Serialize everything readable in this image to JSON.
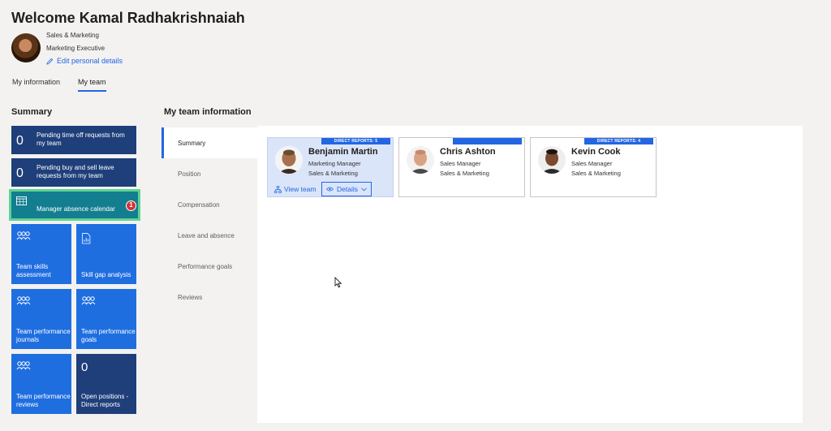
{
  "header": {
    "welcome": "Welcome Kamal Radhakrishnaiah",
    "department": "Sales & Marketing",
    "job_title": "Marketing Executive",
    "edit_link": "Edit personal details"
  },
  "tabs": [
    {
      "label": "My information",
      "active": false
    },
    {
      "label": "My team",
      "active": true
    }
  ],
  "summary": {
    "title": "Summary",
    "tiles": {
      "pending_time_off": {
        "count": "0",
        "label": "Pending time off requests from my team"
      },
      "pending_buy_sell": {
        "count": "0",
        "label": "Pending buy and sell leave requests from my team"
      },
      "manager_calendar": {
        "label": "Manager absence calendar",
        "badge": "1"
      },
      "skills_assessment": {
        "label": "Team skills assessment"
      },
      "skill_gap": {
        "label": "Skill gap analysis"
      },
      "perf_journals": {
        "label": "Team performance journals"
      },
      "perf_goals": {
        "label": "Team performance goals"
      },
      "perf_reviews": {
        "label": "Team performance reviews"
      },
      "open_positions": {
        "count": "0",
        "label": "Open positions - Direct reports"
      }
    }
  },
  "team_info": {
    "title": "My team information",
    "nav": [
      {
        "label": "Summary",
        "active": true
      },
      {
        "label": "Position",
        "active": false
      },
      {
        "label": "Compensation",
        "active": false
      },
      {
        "label": "Leave and absence",
        "active": false
      },
      {
        "label": "Performance goals",
        "active": false
      },
      {
        "label": "Reviews",
        "active": false
      }
    ],
    "cards": [
      {
        "name": "Benjamin Martin",
        "role": "Marketing Manager",
        "org": "Sales & Marketing",
        "banner": "DIRECT REPORTS: 5",
        "selected": true,
        "view_team": "View team",
        "details": "Details"
      },
      {
        "name": "Chris Ashton",
        "role": "Sales Manager",
        "org": "Sales & Marketing",
        "banner": "",
        "selected": false
      },
      {
        "name": "Kevin Cook",
        "role": "Sales Manager",
        "org": "Sales & Marketing",
        "banner": "DIRECT REPORTS: 4",
        "selected": false
      }
    ]
  },
  "colors": {
    "accent": "#2266e3",
    "tile_dark": "#1e3f7a",
    "tile_blue": "#1f6ee0",
    "tile_teal": "#127e8f",
    "highlight": "#5fd292",
    "badge": "#d13438"
  },
  "icons": [
    "pencil-icon",
    "calendar-icon",
    "people-icon",
    "report-icon",
    "org-chart-icon",
    "eye-icon",
    "chevron-down-icon",
    "mouse-pointer-icon"
  ]
}
